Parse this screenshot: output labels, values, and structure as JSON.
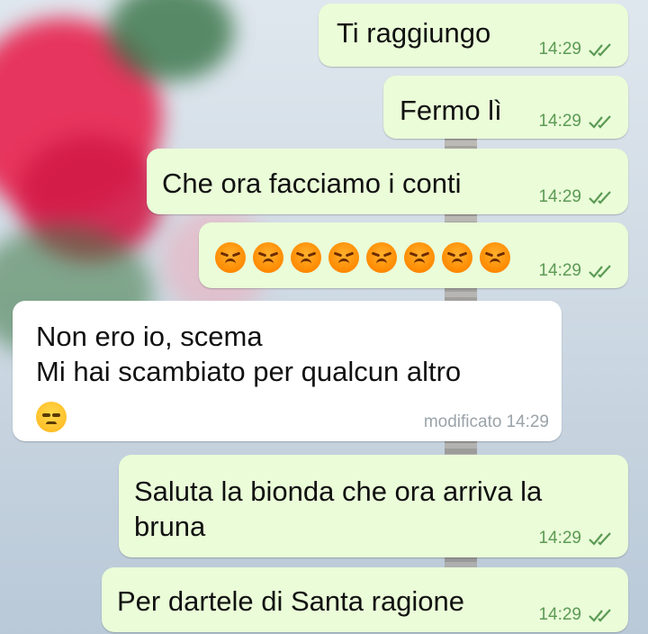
{
  "messages": [
    {
      "text": "Ti raggiungo",
      "time": "14:29",
      "direction": "out",
      "status": "read"
    },
    {
      "text": "Fermo lì",
      "time": "14:29",
      "direction": "out",
      "status": "read"
    },
    {
      "text": "Che ora facciamo i conti",
      "time": "14:29",
      "direction": "out",
      "status": "read"
    },
    {
      "emoji_name": "pouting-face",
      "emoji_count": 8,
      "time": "14:29",
      "direction": "out",
      "status": "read"
    },
    {
      "text": "Non ero io, scema\nMi hai scambiato per qualcun altro",
      "emoji_name": "unamused-face",
      "edited_label": "modificato",
      "time": "14:29",
      "direction": "in"
    },
    {
      "text": "Saluta la bionda che ora arriva la\nbruna",
      "time": "14:29",
      "direction": "out",
      "status": "read"
    },
    {
      "text": "Per dartele di Santa ragione",
      "time": "14:29",
      "direction": "out",
      "status": "read"
    }
  ],
  "colors": {
    "outgoing_bubble": "#eafcd8",
    "incoming_bubble": "#ffffff",
    "read_check": "#5c9a55",
    "meta_incoming": "#9aa3a9"
  }
}
